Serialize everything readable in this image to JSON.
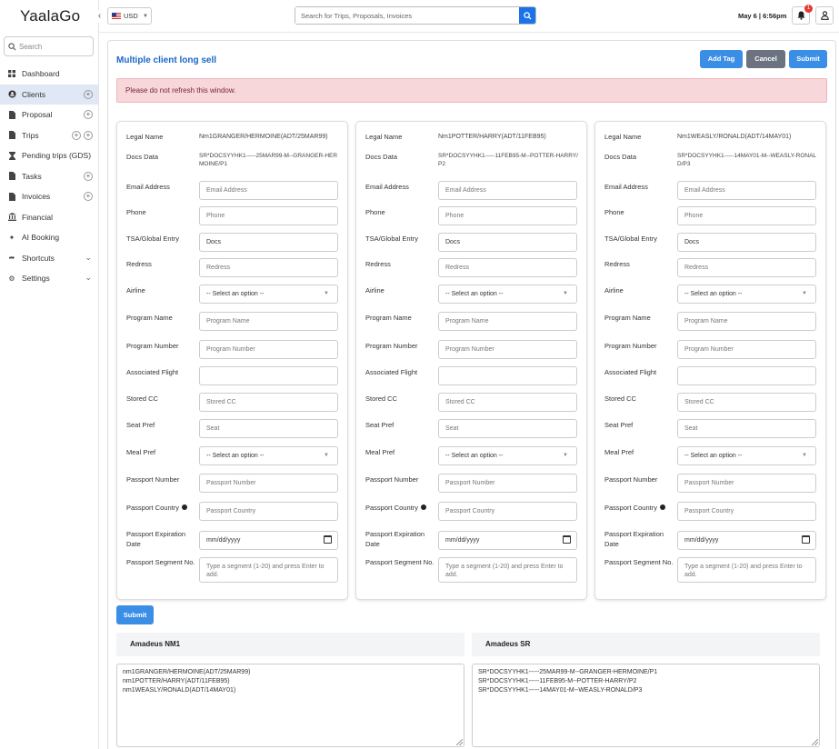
{
  "app": {
    "logo": "YaalaGo"
  },
  "sidebar": {
    "search_placeholder": "Search",
    "items": [
      {
        "label": "Dashboard",
        "icon": "grid-icon"
      },
      {
        "label": "Clients",
        "icon": "users-icon",
        "active": true
      },
      {
        "label": "Proposal",
        "icon": "document-icon"
      },
      {
        "label": "Trips",
        "icon": "document-icon"
      },
      {
        "label": "Pending trips (GDS)",
        "icon": "hourglass-icon"
      },
      {
        "label": "Tasks",
        "icon": "document-icon"
      },
      {
        "label": "Invoices",
        "icon": "document-icon"
      },
      {
        "label": "Financial",
        "icon": "bank-icon"
      },
      {
        "label": "AI Booking",
        "icon": "sparkle-icon"
      },
      {
        "label": "Shortcuts",
        "icon": "share-icon"
      },
      {
        "label": "Settings",
        "icon": "gear-icon"
      }
    ]
  },
  "topbar": {
    "currency": "USD",
    "search_placeholder": "Search for Trips, Proposals, Invoices",
    "datetime": "May 6 | 6:56pm",
    "notification_count": "1"
  },
  "page": {
    "title": "Multiple client long sell",
    "add_tag": "Add Tag",
    "cancel": "Cancel",
    "submit": "Submit",
    "warning": "Please do not refresh this window.",
    "submit_bottom": "Submit"
  },
  "labels": {
    "legal_name": "Legal Name",
    "docs_data": "Docs Data",
    "email": "Email Address",
    "phone": "Phone",
    "tsa": "TSA/Global Entry",
    "redress": "Redress",
    "airline": "Airline",
    "program_name": "Program Name",
    "program_number": "Program Number",
    "associated_flight": "Associated Flight",
    "stored_cc": "Stored CC",
    "seat_pref": "Seat Pref",
    "meal_pref": "Meal Pref",
    "passport_number": "Passport Number",
    "passport_country": "Passport Country",
    "passport_expiration": "Passport Expiration Date",
    "passport_segment": "Passport Segment No."
  },
  "placeholders": {
    "email": "Email Address",
    "phone": "Phone",
    "tsa": "Docs",
    "redress": "Redress",
    "select": "-- Select an option --",
    "program_name": "Program Name",
    "program_number": "Program Number",
    "associated_flight": "",
    "stored_cc": "Stored CC",
    "seat": "Seat",
    "passport_number": "Passport Number",
    "passport_country": "Passport Country",
    "date": "mm/dd/yyyy",
    "segment": "Type a segment (1-20) and press Enter to add."
  },
  "clients": [
    {
      "legal_name": "Nm1GRANGER/HERMOINE(ADT/25MAR99)",
      "docs_data": "SR*DOCSYYHK1-----25MAR99-M--GRANGER-HERMOINE/P1"
    },
    {
      "legal_name": "Nm1POTTER/HARRY(ADT/11FEB95)",
      "docs_data": "SR*DOCSYYHK1-----11FEB95-M--POTTER-HARRY/P2"
    },
    {
      "legal_name": "Nm1WEASLY/RONALD(ADT/14MAY01)",
      "docs_data": "SR*DOCSYYHK1-----14MAY01-M--WEASLY-RONALD/P3"
    }
  ],
  "amadeus": {
    "nm1_title": "Amadeus NM1",
    "nm1_lines": [
      "nm1GRANGER/HERMOINE(ADT/25MAR99)",
      "nm1POTTER/HARRY(ADT/11FEB95)",
      "nm1WEASLY/RONALD(ADT/14MAY01)"
    ],
    "sr_title": "Amadeus SR",
    "sr_lines": [
      "SR*DOCSYYHK1-----25MAR99-M--GRANGER-HERMOINE/P1",
      "SR*DOCSYYHK1-----11FEB95-M--POTTER-HARRY/P2",
      "SR*DOCSYYHK1-----14MAY01-M--WEASLY-RONALD/P3"
    ]
  }
}
